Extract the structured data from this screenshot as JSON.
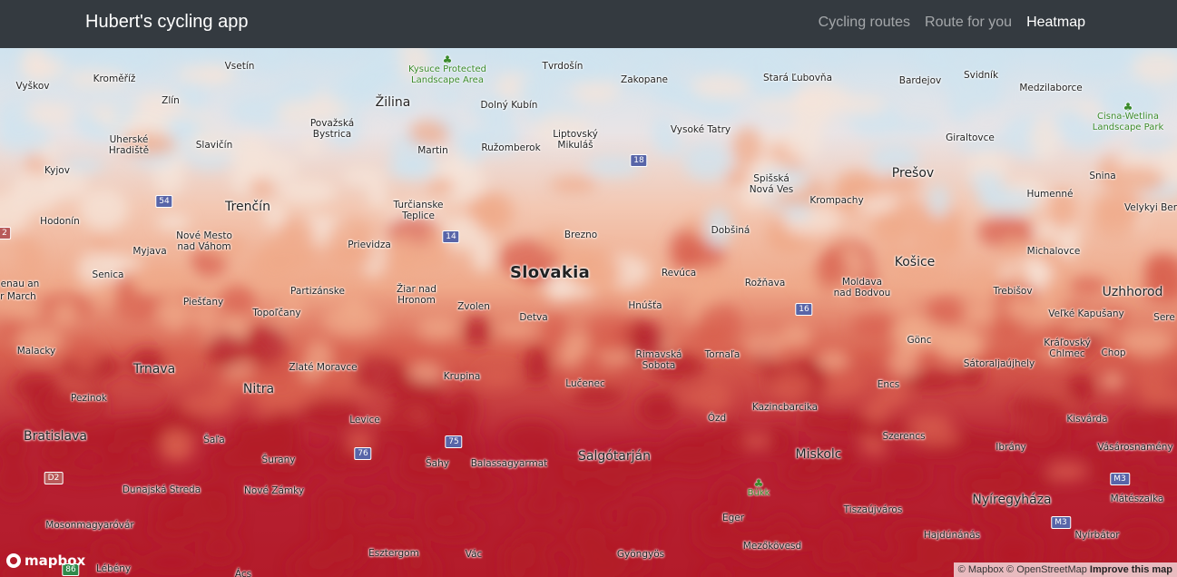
{
  "app": {
    "brand": "Hubert's cycling app"
  },
  "nav": [
    {
      "label": "Cycling routes",
      "active": false
    },
    {
      "label": "Route for you",
      "active": false
    },
    {
      "label": "Heatmap",
      "active": true
    }
  ],
  "map": {
    "country_label": "Slovakia",
    "heat_colors": {
      "cold": "#cfe3ef",
      "light": "#f6e4d9",
      "mid": "#efa98a",
      "warm": "#d8604f",
      "hot": "#b31b2a"
    },
    "cities": [
      "Vyškov",
      "Kroměříž",
      "Vsetín",
      "Zlín",
      "Žilina",
      "Dolný Kubín",
      "Tvrdošín",
      "Zakopane",
      "Stará Ľubovňa",
      "Bardejov",
      "Svidník",
      "Medzilaborce",
      "Uherské Hradiště",
      "Slavičín",
      "Považská Bystrica",
      "Martin",
      "Ružomberok",
      "Liptovský Mikuláš",
      "Vysoké Tatry",
      "Giraltovce",
      "Kyjov",
      "Trenčín",
      "Turčianske Teplice",
      "Spišská Nová Ves",
      "Krompachy",
      "Prešov",
      "Humenné",
      "Snina",
      "Velykyi Ber",
      "Hodonín",
      "Nové Mesto nad Váhom",
      "Myjava",
      "Prievidza",
      "Brezno",
      "Dobšiná",
      "Michalovce",
      "Senica",
      "Revúca",
      "Rožňava",
      "Moldava nad Bodvou",
      "Košice",
      "Trebišov",
      "Uzhhorod",
      "Piešťany",
      "Partizánske",
      "Žiar nad Hronom",
      "Zvolen",
      "Detva",
      "Hnúšťa",
      "Topoľčany",
      "Veľké Kapušany",
      "Malacky",
      "Gönc",
      "Kráľovský Chlmec",
      "Chop",
      "Trnava",
      "Zlaté Moravce",
      "Krupina",
      "Rimavská Sobota",
      "Tornaľa",
      "Sátoraljaújhely",
      "Nitra",
      "Pezinok",
      "Lučenec",
      "Encs",
      "Bratislava",
      "Levice",
      "Ózd",
      "Kazincbarcika",
      "Kisvárda",
      "Šaľa",
      "Šurany",
      "Šahy",
      "Balassagyarmat",
      "Salgótarján",
      "Miskolc",
      "Szerencs",
      "Ibrány",
      "Vásárosnamény",
      "Dunajská Streda",
      "Nové Zámky",
      "Eger",
      "Tiszaújváros",
      "Nyíregyháza",
      "Mátészalka",
      "Mosonmagyaróvár",
      "Hajdúnánás",
      "Nyírbátor",
      "Esztergom",
      "Vác",
      "Gyöngyös",
      "Mezőkövesd",
      "Lébény",
      "Ács",
      "enau an",
      "r March",
      "Sere"
    ],
    "parks": [
      "Kysuce Protected Landscape Area",
      "Cisna-Wetlina Landscape Park",
      "Bükk"
    ],
    "shields": [
      "54",
      "18",
      "14",
      "16",
      "2",
      "76",
      "75",
      "D2",
      "M3",
      "M3",
      "86"
    ]
  },
  "attribution": {
    "mapbox": "© Mapbox",
    "osm": "© OpenStreetMap",
    "improve": "Improve this map"
  },
  "logo": {
    "text": "mapbox"
  }
}
